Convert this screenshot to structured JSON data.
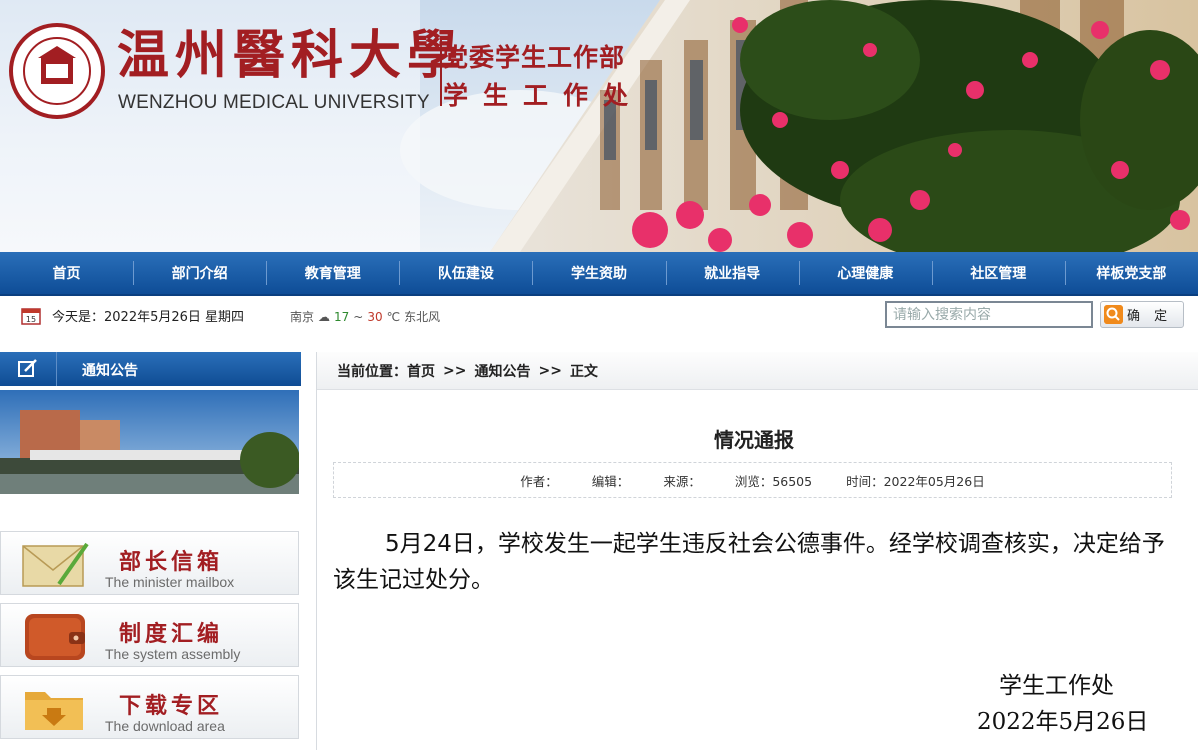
{
  "brand": {
    "name_cn": "温州醫科大學",
    "name_en": "WENZHOU MEDICAL UNIVERSITY",
    "dept_line1": "党委学生工作部",
    "dept_line2": "学生工作处"
  },
  "nav": {
    "items": [
      "首页",
      "部门介绍",
      "教育管理",
      "队伍建设",
      "学生资助",
      "就业指导",
      "心理健康",
      "社区管理",
      "样板党支部"
    ]
  },
  "infobar": {
    "today": "今天是：2022年5月26日 星期四",
    "city": "南京",
    "temp_low": "17",
    "temp_high": "30",
    "wind": "东北风"
  },
  "search": {
    "placeholder": "请输入搜索内容",
    "button_label": "确 定"
  },
  "sidebar": {
    "section_title": "通知公告",
    "links": [
      {
        "cn": "部长信箱",
        "en": "The minister mailbox",
        "icon": "envelope-icon"
      },
      {
        "cn": "制度汇编",
        "en": "The system assembly",
        "icon": "wallet-icon"
      },
      {
        "cn": "下载专区",
        "en": "The download area",
        "icon": "folder-download-icon"
      }
    ]
  },
  "breadcrumb": {
    "label": "当前位置：",
    "items": [
      "首页",
      "通知公告",
      "正文"
    ],
    "sep": ">>"
  },
  "article": {
    "title": "情况通报",
    "meta": {
      "author": "作者：",
      "editor": "编辑：",
      "source": "来源：",
      "views": "浏览：56505",
      "date": "时间：2022年05月26日"
    },
    "body": "5月24日，学校发生一起学生违反社会公德事件。经学校调查核实，决定给予该生记过处分。",
    "signature_org": "学生工作处",
    "signature_date": "2022年5月26日"
  },
  "colors": {
    "nav_blue": "#0e4d97",
    "brand_red": "#a21e22"
  }
}
